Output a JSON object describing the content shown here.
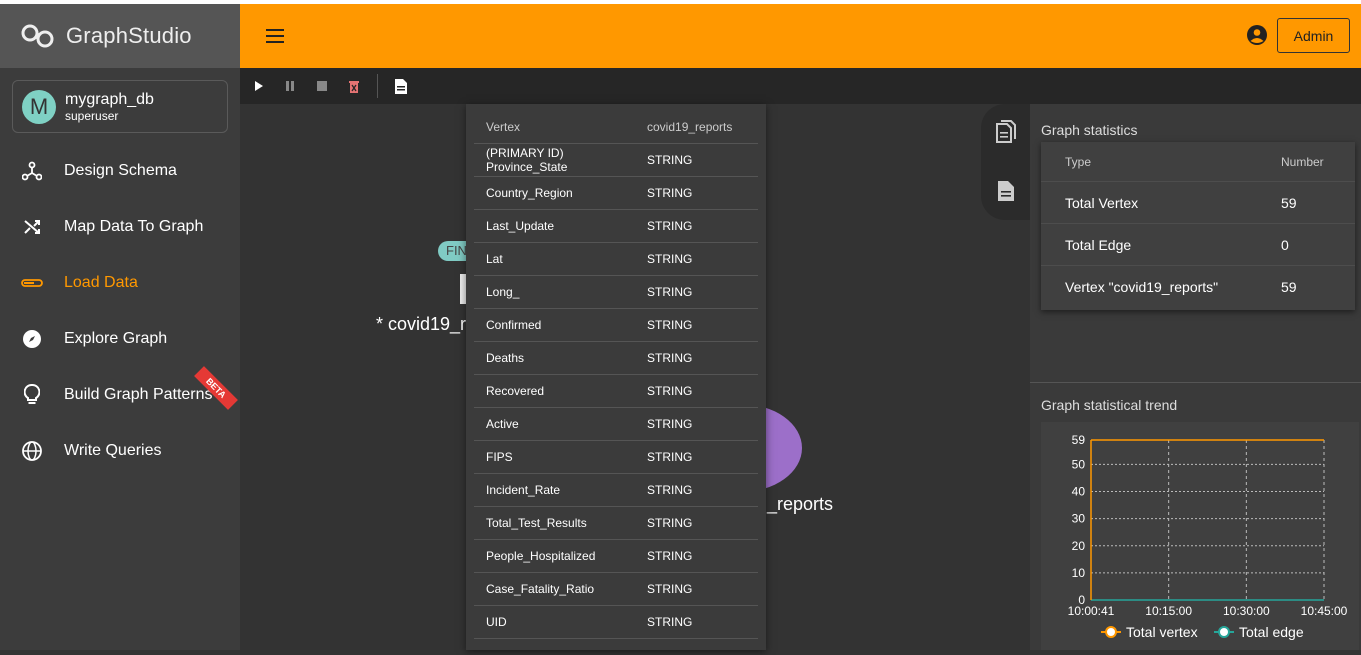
{
  "app": {
    "logo_text": "GraphStudio"
  },
  "db": {
    "initial": "M",
    "name": "mygraph_db",
    "role": "superuser"
  },
  "nav": [
    {
      "label": "Design Schema",
      "icon": "schema-icon"
    },
    {
      "label": "Map Data To Graph",
      "icon": "shuffle-icon"
    },
    {
      "label": "Load Data",
      "icon": "load-bar-icon",
      "active": true
    },
    {
      "label": "Explore Graph",
      "icon": "compass-icon"
    },
    {
      "label": "Build Graph Patterns",
      "icon": "lightbulb-icon",
      "badge": "BETA"
    },
    {
      "label": "Write Queries",
      "icon": "globe-icon"
    }
  ],
  "header": {
    "admin_label": "Admin"
  },
  "colors": {
    "accent": "#ff9800",
    "vertex_line": "#ff9800",
    "edge_line": "#26a69a",
    "vertex_node": "#9c6fc9"
  },
  "canvas": {
    "chip": "FIN",
    "vertex_label_1": "* covid19_r",
    "vertex_label_2": "_reports"
  },
  "vertex_table": {
    "headers": [
      "Vertex",
      "covid19_reports"
    ],
    "rows": [
      [
        "(PRIMARY ID) Province_State",
        "STRING"
      ],
      [
        "Country_Region",
        "STRING"
      ],
      [
        "Last_Update",
        "STRING"
      ],
      [
        "Lat",
        "STRING"
      ],
      [
        "Long_",
        "STRING"
      ],
      [
        "Confirmed",
        "STRING"
      ],
      [
        "Deaths",
        "STRING"
      ],
      [
        "Recovered",
        "STRING"
      ],
      [
        "Active",
        "STRING"
      ],
      [
        "FIPS",
        "STRING"
      ],
      [
        "Incident_Rate",
        "STRING"
      ],
      [
        "Total_Test_Results",
        "STRING"
      ],
      [
        "People_Hospitalized",
        "STRING"
      ],
      [
        "Case_Fatality_Ratio",
        "STRING"
      ],
      [
        "UID",
        "STRING"
      ]
    ]
  },
  "stats": {
    "title": "Graph statistics",
    "headers": [
      "Type",
      "Number"
    ],
    "rows": [
      [
        "Total Vertex",
        "59"
      ],
      [
        "Total Edge",
        "0"
      ],
      [
        "Vertex \"covid19_reports\"",
        "59"
      ]
    ]
  },
  "trend_title": "Graph statistical trend",
  "chart_data": {
    "type": "line",
    "x": [
      "10:00:41",
      "10:15:00",
      "10:30:00",
      "10:45:00"
    ],
    "yticks": [
      0,
      10,
      20,
      30,
      40,
      50,
      59
    ],
    "ylim": [
      0,
      59
    ],
    "series": [
      {
        "name": "Total vertex",
        "values": [
          59,
          59,
          59,
          59
        ]
      },
      {
        "name": "Total edge",
        "values": [
          0,
          0,
          0,
          0
        ]
      }
    ],
    "grid": true,
    "legend": "bottom"
  }
}
